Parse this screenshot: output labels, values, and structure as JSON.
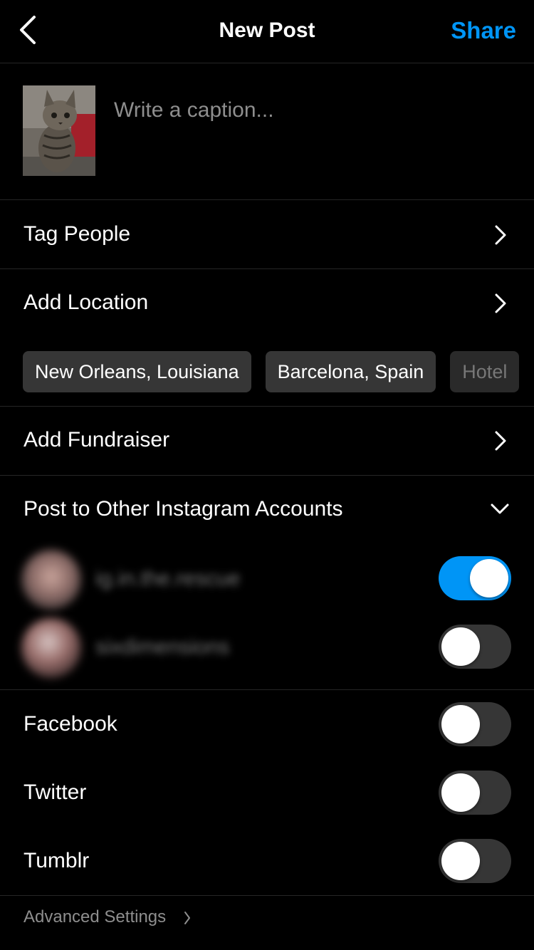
{
  "header": {
    "title": "New Post",
    "share_label": "Share"
  },
  "caption": {
    "placeholder": "Write a caption...",
    "value": ""
  },
  "rows": {
    "tag_people": "Tag People",
    "add_location": "Add Location",
    "add_fundraiser": "Add Fundraiser",
    "post_other_accounts": "Post to Other Instagram Accounts"
  },
  "location_suggestions": [
    "New Orleans, Louisiana",
    "Barcelona, Spain",
    "Hotel"
  ],
  "accounts": [
    {
      "name": "ig.in.the.rescue",
      "enabled": true
    },
    {
      "name": "sixdimensions",
      "enabled": false
    }
  ],
  "share_to": [
    {
      "label": "Facebook",
      "enabled": false
    },
    {
      "label": "Twitter",
      "enabled": false
    },
    {
      "label": "Tumblr",
      "enabled": false
    }
  ],
  "advanced_settings": "Advanced Settings",
  "colors": {
    "accent": "#0095f6",
    "background": "#000000",
    "chip_background": "#363636",
    "toggle_off": "#363636",
    "placeholder": "#8e8e8e"
  },
  "icons": {
    "back": "chevron-left-icon",
    "row_chevron": "chevron-right-icon",
    "expand": "chevron-down-icon"
  }
}
